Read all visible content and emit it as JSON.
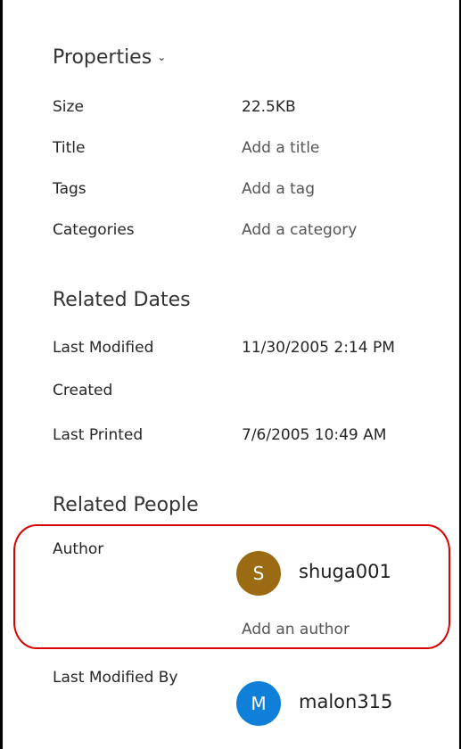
{
  "properties": {
    "heading": "Properties",
    "rows": [
      {
        "label": "Size",
        "value": "22.5KB"
      },
      {
        "label": "Title",
        "placeholder": "Add a title"
      },
      {
        "label": "Tags",
        "placeholder": "Add a tag"
      },
      {
        "label": "Categories",
        "placeholder": "Add a category"
      }
    ]
  },
  "related_dates": {
    "heading": "Related Dates",
    "rows": [
      {
        "label": "Last Modified",
        "value": "11/30/2005 2:14 PM"
      },
      {
        "label": "Created",
        "value": ""
      },
      {
        "label": "Last Printed",
        "value": "7/6/2005 10:49 AM"
      }
    ]
  },
  "related_people": {
    "heading": "Related People",
    "author": {
      "label": "Author",
      "initial": "S",
      "name": "shuga001",
      "avatar_color": "#9a6b12",
      "add_placeholder": "Add an author"
    },
    "last_modified_by": {
      "label": "Last Modified By",
      "initial": "M",
      "name": "malon315",
      "avatar_color": "#0f7fd9"
    }
  },
  "colors": {
    "highlight": "#d90000"
  }
}
